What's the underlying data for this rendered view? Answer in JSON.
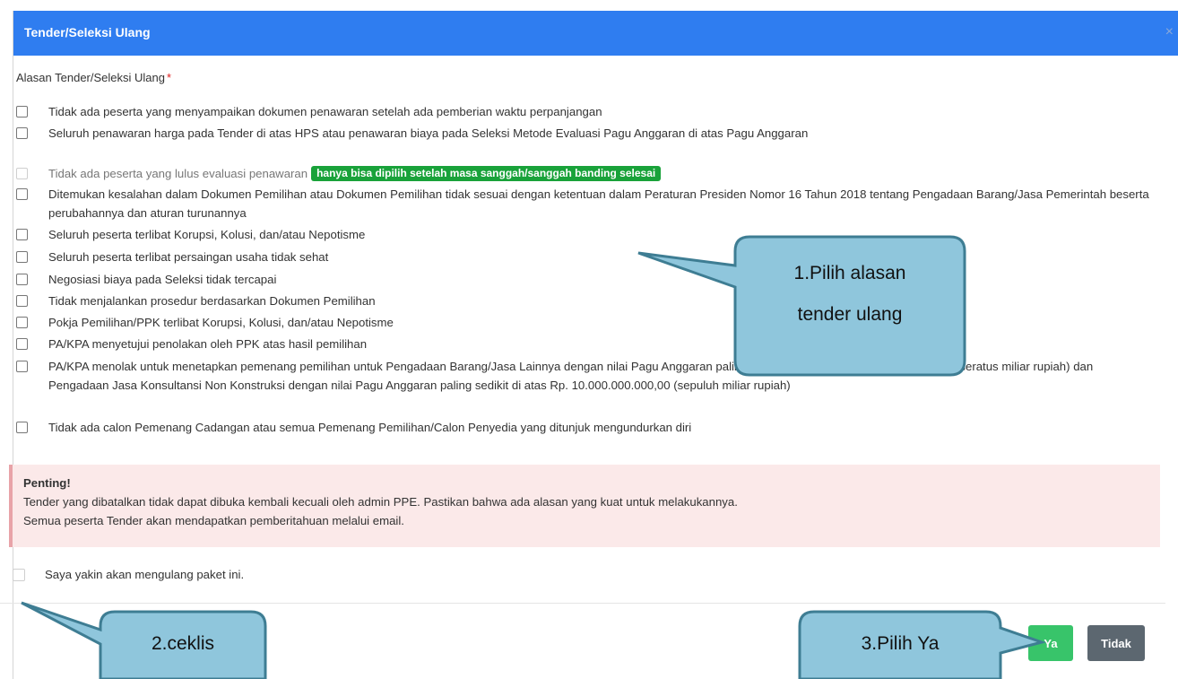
{
  "dialog": {
    "title": "Tender/Seleksi Ulang",
    "close_glyph": "×"
  },
  "reason": {
    "label": "Alasan Tender/Seleksi Ulang",
    "required_mark": "*",
    "options": [
      "Tidak ada peserta yang menyampaikan dokumen penawaran setelah ada pemberian waktu perpanjangan",
      "Seluruh penawaran harga pada Tender di atas HPS atau penawaran biaya pada Seleksi Metode Evaluasi Pagu Anggaran di atas Pagu Anggaran",
      "Tidak ada peserta yang lulus evaluasi penawaran",
      "Ditemukan kesalahan dalam Dokumen Pemilihan atau Dokumen Pemilihan tidak sesuai dengan ketentuan dalam Peraturan Presiden Nomor 16 Tahun 2018 tentang Pengadaan Barang/Jasa Pemerintah beserta perubahannya dan aturan turunannya",
      "Seluruh peserta terlibat Korupsi, Kolusi, dan/atau Nepotisme",
      "Seluruh peserta terlibat persaingan usaha tidak sehat",
      "Negosiasi biaya pada Seleksi tidak tercapai",
      "Tidak menjalankan prosedur berdasarkan Dokumen Pemilihan",
      "Pokja Pemilihan/PPK terlibat Korupsi, Kolusi, dan/atau Nepotisme",
      "PA/KPA menyetujui penolakan oleh PPK atas hasil pemilihan",
      "PA/KPA menolak untuk menetapkan pemenang pemilihan untuk Pengadaan Barang/Jasa Lainnya dengan nilai Pagu Anggaran paling sedikit di atas Rp. 100.000.000.000,00 (seratus miliar rupiah) dan Pengadaan Jasa Konsultansi Non Konstruksi dengan nilai Pagu Anggaran paling sedikit di atas Rp. 10.000.000.000,00 (sepuluh miliar rupiah)",
      "Tidak ada calon Pemenang Cadangan atau semua Pemenang Pemilihan/Calon Penyedia yang ditunjuk mengundurkan diri"
    ],
    "disabled_badge": "hanya bisa dipilih setelah masa sanggah/sanggah banding selesai"
  },
  "alert": {
    "title": "Penting!",
    "line1": "Tender yang dibatalkan tidak dapat dibuka kembali kecuali oleh admin PPE. Pastikan bahwa ada alasan yang kuat untuk melakukannya.",
    "line2": "Semua peserta Tender akan mendapatkan pemberitahuan melalui email."
  },
  "confirm": {
    "label": "Saya yakin akan mengulang paket ini."
  },
  "buttons": {
    "yes": "Ya",
    "no": "Tidak"
  },
  "annotations": {
    "callout1_line1": "1.Pilih alasan",
    "callout1_line2": "tender ulang",
    "callout2": "2.ceklis",
    "callout3": "3.Pilih Ya"
  },
  "colors": {
    "header": "#2f7df0",
    "badge": "#19a23a",
    "yes_button": "#38c46a",
    "no_button": "#5c6770",
    "callout_fill": "#8fc6dc",
    "callout_stroke": "#3e7d93"
  }
}
